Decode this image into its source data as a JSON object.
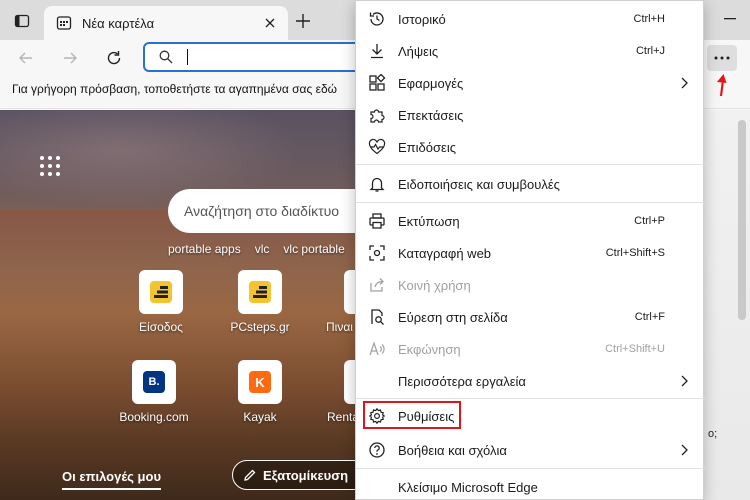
{
  "tab": {
    "title": "Νέα καρτέλα"
  },
  "favorites_bar": {
    "text": "Για γρήγορη πρόσβαση, τοποθετήστε τα αγαπημένα σας εδώ"
  },
  "ntp": {
    "search_placeholder": "Αναζήτηση στο διαδίκτυο",
    "quick_links": [
      "portable apps",
      "vlc",
      "vlc portable"
    ],
    "tiles": [
      {
        "label": "Είσοδος"
      },
      {
        "label": "PCsteps.gr"
      },
      {
        "label": "Πιναι"
      },
      {
        "label": "Booking.com"
      },
      {
        "label": "Kayak"
      },
      {
        "label": "Renta"
      }
    ],
    "tile_letters": {
      "booking": "B.",
      "kayak": "K"
    },
    "my_choices": "Οι επιλογές μου",
    "customize": "Εξατομίκευση",
    "right_edge_text": "o;"
  },
  "menu": {
    "items": [
      {
        "label": "Ιστορικό",
        "shortcut": "Ctrl+H"
      },
      {
        "label": "Λήψεις",
        "shortcut": "Ctrl+J"
      },
      {
        "label": "Εφαρμογές",
        "shortcut": ""
      },
      {
        "label": "Επεκτάσεις",
        "shortcut": ""
      },
      {
        "label": "Επιδόσεις",
        "shortcut": ""
      },
      {
        "label": "Ειδοποιήσεις και συμβουλές",
        "shortcut": ""
      },
      {
        "label": "Εκτύπωση",
        "shortcut": "Ctrl+P"
      },
      {
        "label": "Καταγραφή web",
        "shortcut": "Ctrl+Shift+S"
      },
      {
        "label": "Κοινή χρήση",
        "shortcut": ""
      },
      {
        "label": "Εύρεση στη σελίδα",
        "shortcut": "Ctrl+F"
      },
      {
        "label": "Εκφώνηση",
        "shortcut": "Ctrl+Shift+U"
      },
      {
        "label": "Περισσότερα εργαλεία",
        "shortcut": ""
      },
      {
        "label": "Ρυθμίσεις",
        "shortcut": ""
      },
      {
        "label": "Βοήθεια και σχόλια",
        "shortcut": ""
      },
      {
        "label": "Κλείσιμο Microsoft Edge",
        "shortcut": ""
      }
    ]
  },
  "colors": {
    "accent": "#2a6fd6",
    "highlight": "#e0151c",
    "pcsteps": "#f4c430",
    "booking": "#003580",
    "kayak": "#ff690f"
  },
  "icons": [
    "tab-actions-icon",
    "newtab-favicon-icon",
    "close-icon",
    "plus-icon",
    "back-icon",
    "forward-icon",
    "refresh-icon",
    "search-icon",
    "more-icon",
    "apps-grid-icon",
    "history-icon",
    "download-icon",
    "apps-icon",
    "extensions-icon",
    "performance-icon",
    "bell-icon",
    "print-icon",
    "web-capture-icon",
    "share-icon",
    "find-icon",
    "read-aloud-icon",
    "gear-icon",
    "help-icon",
    "chevron-right-icon",
    "pen-icon"
  ]
}
